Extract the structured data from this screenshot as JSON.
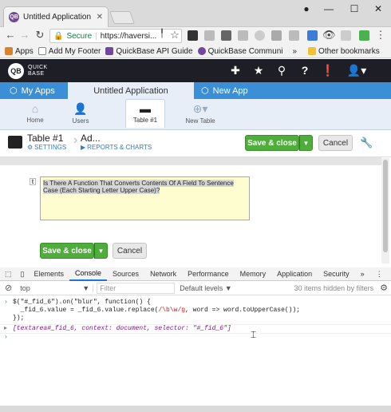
{
  "browser": {
    "tab_title": "Untitled Application - Ad",
    "tab_favicon": "QB",
    "url_secure": "Secure",
    "url": "https://haversi...",
    "bookmarks": [
      "Apps",
      "Add My Footer",
      "QuickBase API Guide",
      "QuickBase Communi"
    ],
    "bookmarks_more": "»",
    "other_bookmarks": "Other bookmarks"
  },
  "qb": {
    "logo_mark": "QB",
    "logo_line1": "QUICK",
    "logo_line2": "BASE",
    "tabs": {
      "my_apps": "My Apps",
      "current_app": "Untitled Application",
      "new_app": "New App"
    },
    "nav": {
      "home": "Home",
      "users": "Users",
      "table": "Table #1",
      "new_table": "New Table"
    },
    "page": {
      "table_name": "Table #1",
      "settings": "SETTINGS",
      "mode": "Ad...",
      "reports": "REPORTS & CHARTS",
      "save_close": "Save & close",
      "cancel": "Cancel"
    },
    "form": {
      "field_marker": "t",
      "textarea_value": "Is There A Function That Converts Contents Of A Field To Sentence Case (Each Starting Letter Upper Case)?",
      "save_close": "Save & close",
      "cancel": "Cancel"
    }
  },
  "devtools": {
    "tabs": [
      "Elements",
      "Console",
      "Sources",
      "Network",
      "Performance",
      "Memory",
      "Application",
      "Security"
    ],
    "more": "»",
    "context": "top",
    "filter_placeholder": "Filter",
    "levels": "Default levels ▼",
    "hidden": "30 items hidden by filters",
    "line1a": "$(\"#_fid_6\").on(\"blur\", function() {",
    "line2a": "  _fid_6.value = _fid_6.value.replace(",
    "line2_regex": "/\\b\\w/g",
    "line2b": ", word => word.toUpperCase());",
    "line3": "});",
    "result": "[textarea#_fid_6, context: document, selector: \"#_fid_6\"]"
  }
}
